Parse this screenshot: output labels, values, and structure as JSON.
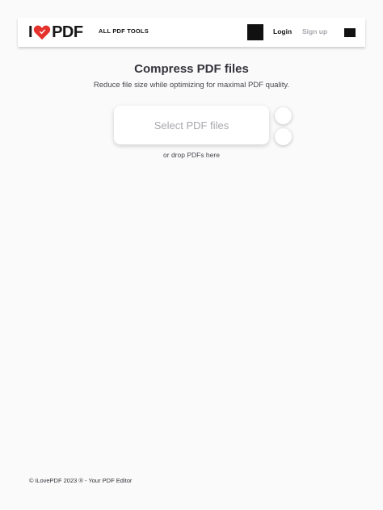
{
  "header": {
    "logo": {
      "left": "I",
      "right": "PDF",
      "brand_color": "#e5322d"
    },
    "nav_tools_label": "ALL PDF TOOLS",
    "login_label": "Login",
    "signup_label": "Sign up"
  },
  "main": {
    "title": "Compress PDF files",
    "subtitle": "Reduce file size while optimizing for maximal PDF quality.",
    "select_label": "Select PDF files",
    "drop_text": "or drop PDFs here"
  },
  "footer": {
    "text": "© iLovePDF 2023 ® - Your PDF Editor"
  }
}
